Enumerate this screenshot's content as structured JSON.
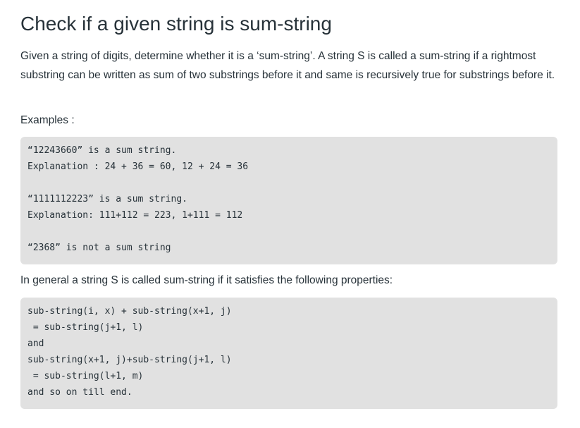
{
  "article": {
    "title": "Check if a given string is sum-string",
    "intro": "Given a string of digits, determine whether it is a ‘sum-string’. A string S is called a sum-string if a rightmost substring can be written as sum of two substrings before it and same is recursively true for substrings before it.",
    "examples_label": "Examples :",
    "examples_code": [
      "“12243660” is a sum string.",
      "Explanation : 24 + 36 = 60, 12 + 24 = 36",
      "“1111112223” is a sum string.",
      "Explanation: 111+112 = 223, 1+111 = 112",
      "“2368” is not a sum string"
    ],
    "general_text": "In general a string S is called sum-string if it satisfies the following properties:",
    "properties_code": [
      "sub-string(i, x) + sub-string(x+1, j)",
      " = sub-string(j+1, l)",
      "and",
      "sub-string(x+1, j)+sub-string(j+1, l)",
      " = sub-string(l+1, m)",
      "and so on till end."
    ]
  }
}
